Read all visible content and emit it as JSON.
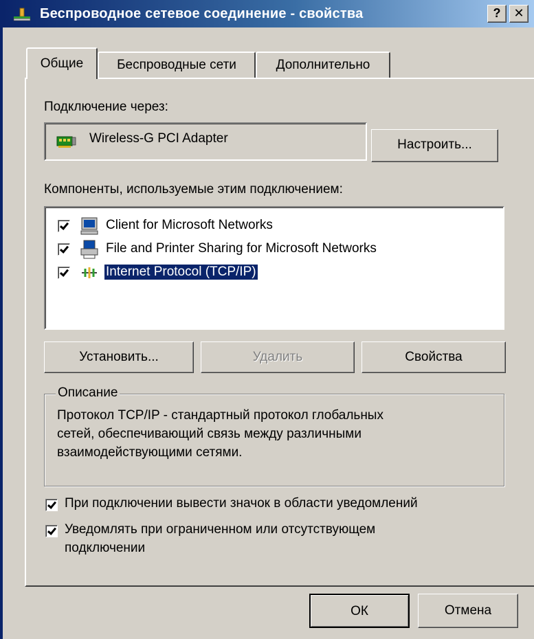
{
  "window": {
    "title": "Беспроводное сетевое соединение - свойства",
    "help_label": "?",
    "close_label": "✕",
    "title_icon": "network-connection-icon"
  },
  "tabs": [
    {
      "label": "Общие",
      "active": true
    },
    {
      "label": "Беспроводные сети",
      "active": false
    },
    {
      "label": "Дополнительно",
      "active": false
    }
  ],
  "general": {
    "connect_using_label": "Подключение через:",
    "adapter": {
      "name": "Wireless-G PCI Adapter",
      "icon": "network-adapter-icon"
    },
    "configure_label": "Настроить...",
    "components_label": "Компоненты, используемые этим подключением:",
    "components": [
      {
        "label": "Client for Microsoft Networks",
        "checked": true,
        "selected": false,
        "icon": "computer-icon"
      },
      {
        "label": "File and Printer Sharing for Microsoft Networks",
        "checked": true,
        "selected": false,
        "icon": "printer-icon"
      },
      {
        "label": "Internet Protocol (TCP/IP)",
        "checked": true,
        "selected": true,
        "icon": "protocol-icon"
      }
    ],
    "install_label": "Установить...",
    "uninstall_label": "Удалить",
    "properties_label": "Свойства",
    "description": {
      "legend": "Описание",
      "lines": [
        "Протокол TCP/IP - стандартный протокол глобальных",
        "сетей, обеспечивающий связь между различными",
        "взаимодействующими сетями."
      ]
    },
    "show_icon": {
      "label": "При подключении вывести значок в области уведомлений",
      "checked": true
    },
    "notify": {
      "lines": [
        "Уведомлять при ограниченном или отсутствующем",
        "подключении"
      ],
      "checked": true
    }
  },
  "footer": {
    "ok_label": "ОК",
    "cancel_label": "Отмена"
  },
  "colors": {
    "selection": "#0a246a",
    "title_start": "#0a246a",
    "title_end": "#a6caf0",
    "face": "#d4d0c8"
  }
}
